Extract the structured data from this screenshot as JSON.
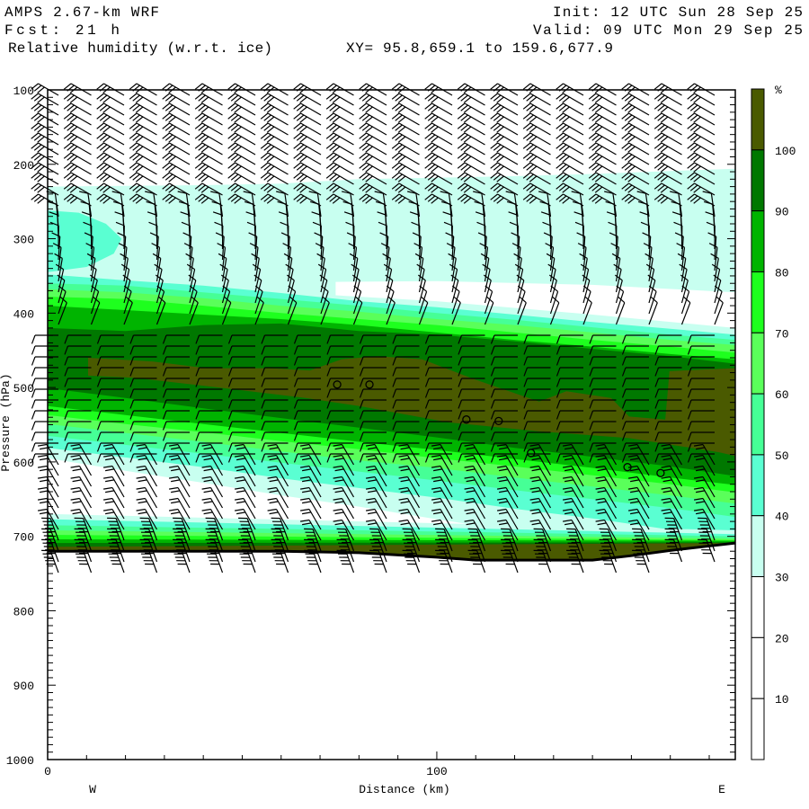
{
  "header": {
    "model": "AMPS 2.67-km WRF",
    "init": "Init: 12 UTC Sun 28 Sep 25",
    "fcst": "Fcst:   21 h",
    "valid": "Valid: 09 UTC Mon 29 Sep 25",
    "field": "Relative humidity (w.r.t. ice)",
    "xy": "XY=  95.8,659.1 to 159.6,677.9"
  },
  "chart_data": {
    "type": "heatmap",
    "subtype": "vertical cross-section, filled contours with wind barbs",
    "title": "Relative humidity (w.r.t. ice)",
    "xlabel": "Distance (km)",
    "ylabel": "Pressure (hPa)",
    "xlim": [
      0,
      176.7
    ],
    "ylim": [
      1000,
      100
    ],
    "xticks": [
      0,
      100
    ],
    "yticks": [
      100,
      200,
      300,
      400,
      500,
      600,
      700,
      800,
      900,
      1000
    ],
    "x_end_labels": {
      "left": "W",
      "right": "E"
    },
    "colorbar": {
      "unit": "%",
      "levels": [
        10,
        20,
        30,
        40,
        50,
        60,
        70,
        80,
        90,
        100
      ],
      "colors": [
        "#ffffff",
        "#ffffff",
        "#ffffff",
        "#c8fff0",
        "#5affd2",
        "#46ff96",
        "#5aff5a",
        "#1eff1e",
        "#00b400",
        "#007800",
        "#4a5a00"
      ]
    },
    "level_colors": {
      "30": "#c8fff0",
      "40": "#5affd2",
      "50": "#46ff96",
      "60": "#5aff5a",
      "70": "#1eff1e",
      "80": "#00b400",
      "90": "#007800",
      "100": "#4a5a00"
    },
    "upper_layer_top_30": {
      "km": [
        0,
        20,
        40,
        60,
        80,
        100,
        120,
        140,
        160,
        176.7
      ],
      "p": [
        230,
        229,
        228,
        226,
        220,
        218,
        216,
        213,
        209,
        206
      ]
    },
    "dry_gap_below_30": {
      "km": [
        74,
        100,
        140,
        176.7
      ],
      "top": [
        358,
        357,
        362,
        372
      ],
      "bottom": [
        376,
        384,
        402,
        420
      ]
    },
    "upper_left_blob_40": [
      [
        0,
        262
      ],
      [
        8,
        265
      ],
      [
        15,
        280
      ],
      [
        19,
        300
      ],
      [
        17,
        320
      ],
      [
        10,
        338
      ],
      [
        0,
        345
      ]
    ],
    "main_band": {
      "km": [
        0,
        20,
        40,
        60,
        80,
        100,
        120,
        140,
        160,
        176.7
      ],
      "top": {
        "40": [
          348,
          356,
          363,
          373,
          384,
          392,
          402,
          412,
          421,
          429
        ],
        "50": [
          360,
          363,
          372,
          381,
          390,
          400,
          409,
          419,
          429,
          436
        ],
        "60": [
          368,
          372,
          380,
          390,
          398,
          408,
          416,
          426,
          436,
          443
        ],
        "70": [
          378,
          381,
          390,
          400,
          408,
          416,
          426,
          436,
          445,
          453
        ],
        "80": [
          390,
          396,
          402,
          408,
          416,
          426,
          436,
          445,
          455,
          462
        ],
        "90": [
          420,
          424,
          416,
          414,
          424,
          429,
          438,
          448,
          458,
          468
        ]
      },
      "bottom": {
        "30": [
          595,
          612,
          628,
          645,
          660,
          677,
          693,
          710,
          726,
          743
        ],
        "40": [
          581,
          594,
          607,
          622,
          635,
          648,
          663,
          676,
          691,
          704
        ],
        "50": [
          565,
          577,
          589,
          601,
          613,
          625,
          638,
          650,
          662,
          674
        ],
        "60": [
          549,
          561,
          573,
          586,
          598,
          608,
          621,
          633,
          645,
          656
        ],
        "70": [
          537,
          549,
          560,
          572,
          583,
          595,
          606,
          618,
          630,
          641
        ],
        "80": [
          525,
          537,
          549,
          561,
          573,
          584,
          596,
          608,
          621,
          631
        ],
        "90": [
          501,
          514,
          528,
          541,
          554,
          567,
          581,
          593,
          606,
          619
        ]
      }
    },
    "saturated_core_100": [
      [
        10.4,
        460
      ],
      [
        27,
        465
      ],
      [
        40.9,
        474
      ],
      [
        57,
        474
      ],
      [
        67.4,
        477
      ],
      [
        75.5,
        462
      ],
      [
        84.8,
        458
      ],
      [
        96.3,
        462
      ],
      [
        110.2,
        490
      ],
      [
        126.3,
        519
      ],
      [
        133.3,
        505
      ],
      [
        144.8,
        514
      ],
      [
        149.4,
        539
      ],
      [
        158.7,
        543
      ],
      [
        159.8,
        478
      ],
      [
        167.9,
        476
      ],
      [
        176.7,
        474
      ],
      [
        176.7,
        592
      ],
      [
        172.5,
        587
      ],
      [
        149.4,
        568
      ],
      [
        126.3,
        559
      ],
      [
        103.2,
        547
      ],
      [
        80.1,
        525
      ],
      [
        66.3,
        514
      ],
      [
        45.5,
        501
      ],
      [
        22.4,
        487
      ],
      [
        10.4,
        484
      ]
    ],
    "surface_layer_tops": {
      "km": [
        0,
        176.7
      ],
      "30": [
        670,
        692
      ],
      "40": [
        677,
        697
      ],
      "50": [
        685,
        700
      ],
      "60": [
        692,
        703
      ],
      "70": [
        698,
        705
      ],
      "80": [
        704,
        706
      ],
      "90": [
        709,
        708
      ],
      "100": [
        714,
        709
      ]
    },
    "terrain": {
      "km": [
        0,
        60,
        80,
        100,
        110,
        140,
        150,
        160,
        170,
        176.7
      ],
      "p": [
        720,
        720,
        722,
        728,
        732,
        732,
        726,
        719,
        713,
        709
      ]
    },
    "calm_points": [
      [
        74.4,
        496
      ],
      [
        82.7,
        496
      ],
      [
        107.6,
        543
      ],
      [
        115.9,
        545
      ],
      [
        124.2,
        588
      ],
      [
        149,
        607
      ],
      [
        157.5,
        615
      ]
    ]
  }
}
